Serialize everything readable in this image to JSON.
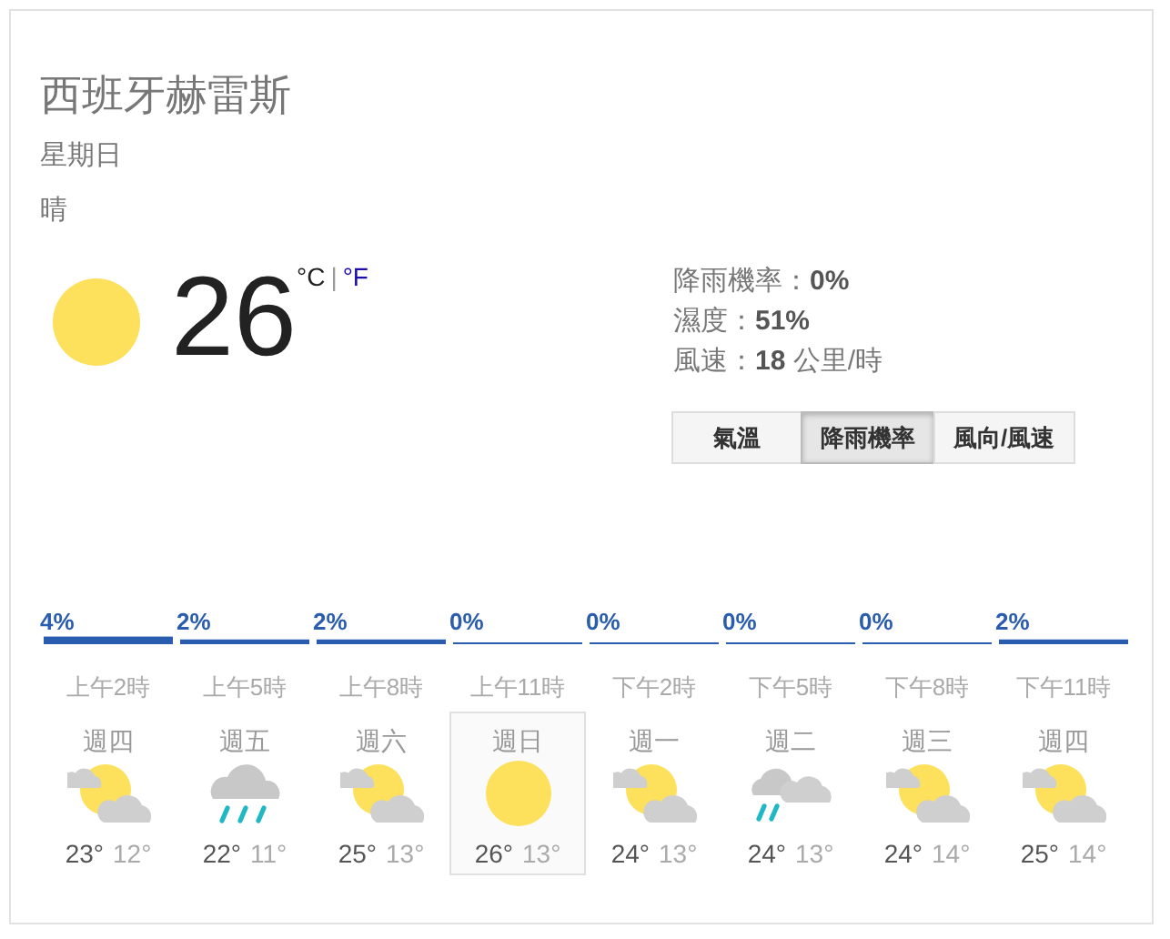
{
  "location": "西班牙赫雷斯",
  "day": "星期日",
  "condition": "晴",
  "current": {
    "kind": "sunny",
    "temperature": "26",
    "units": [
      {
        "label": "°C",
        "selected": true
      },
      {
        "label": "°F",
        "selected": false
      }
    ],
    "separator": "|"
  },
  "details": [
    "降雨機率：**0%**",
    "濕度：**51%**",
    "風速：**18** 公里/時"
  ],
  "tabs": [
    {
      "label": "氣溫",
      "selected": false
    },
    {
      "label": "降雨機率",
      "selected": true
    },
    {
      "label": "風向/風速",
      "selected": false
    }
  ],
  "chart_data": {
    "type": "bar",
    "categories": [
      "上午2時",
      "上午5時",
      "上午8時",
      "上午11時",
      "下午2時",
      "下午5時",
      "下午8時",
      "下午11時"
    ],
    "values": [
      4,
      2,
      2,
      0,
      0,
      0,
      0,
      2
    ],
    "value_labels": [
      "4%",
      "2%",
      "2%",
      "0%",
      "0%",
      "0%",
      "0%",
      "2%"
    ]
  },
  "forecast": [
    {
      "day": "週四",
      "kind": "partly_cloudy",
      "high": "23°",
      "low": "12°",
      "selected": false
    },
    {
      "day": "週五",
      "kind": "rain",
      "high": "22°",
      "low": "11°",
      "selected": false
    },
    {
      "day": "週六",
      "kind": "partly_cloudy",
      "high": "25°",
      "low": "13°",
      "selected": false
    },
    {
      "day": "週日",
      "kind": "sunny",
      "high": "26°",
      "low": "13°",
      "selected": true
    },
    {
      "day": "週一",
      "kind": "partly_cloudy",
      "high": "24°",
      "low": "13°",
      "selected": false
    },
    {
      "day": "週二",
      "kind": "showers",
      "high": "24°",
      "low": "13°",
      "selected": false
    },
    {
      "day": "週三",
      "kind": "partly_cloudy",
      "high": "24°",
      "low": "14°",
      "selected": false
    },
    {
      "day": "週四",
      "kind": "partly_cloudy",
      "high": "25°",
      "low": "14°",
      "selected": false
    }
  ]
}
